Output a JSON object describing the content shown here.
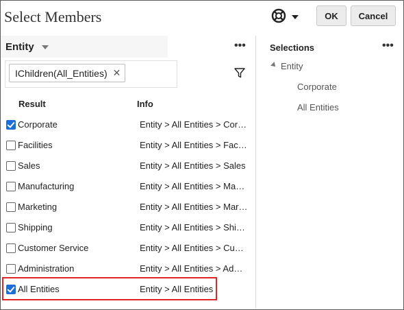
{
  "dialog": {
    "title": "Select Members",
    "ok_label": "OK",
    "cancel_label": "Cancel",
    "help_icon": "lifebuoy-icon"
  },
  "left_panel": {
    "dimension_label": "Entity",
    "more_label": "•••",
    "filter_chip": "IChildren(All_Entities)",
    "chip_remove": "✕",
    "columns": {
      "result": "Result",
      "info": "Info"
    },
    "rows": [
      {
        "result": "Corporate",
        "info": "Entity > All Entities > Corporate",
        "checked": true
      },
      {
        "result": "Facilities",
        "info": "Entity > All Entities > Facilities",
        "checked": false
      },
      {
        "result": "Sales",
        "info": "Entity > All Entities > Sales",
        "checked": false
      },
      {
        "result": "Manufacturing",
        "info": "Entity > All Entities > Manufacturing",
        "checked": false
      },
      {
        "result": "Marketing",
        "info": "Entity > All Entities > Marketing",
        "checked": false
      },
      {
        "result": "Shipping",
        "info": "Entity > All Entities > Shipping",
        "checked": false
      },
      {
        "result": "Customer Service",
        "info": "Entity > All Entities > Customer Service",
        "checked": false
      },
      {
        "result": "Administration",
        "info": "Entity > All Entities > Administration",
        "checked": false
      },
      {
        "result": "All Entities",
        "info": "Entity > All Entities",
        "checked": true
      }
    ]
  },
  "right_panel": {
    "title": "Selections",
    "more_label": "•••",
    "tree_root": "Entity",
    "tree_children": [
      "Corporate",
      "All Entities"
    ]
  },
  "colors": {
    "accent": "#1c6ed9",
    "highlight": "#e02525"
  }
}
